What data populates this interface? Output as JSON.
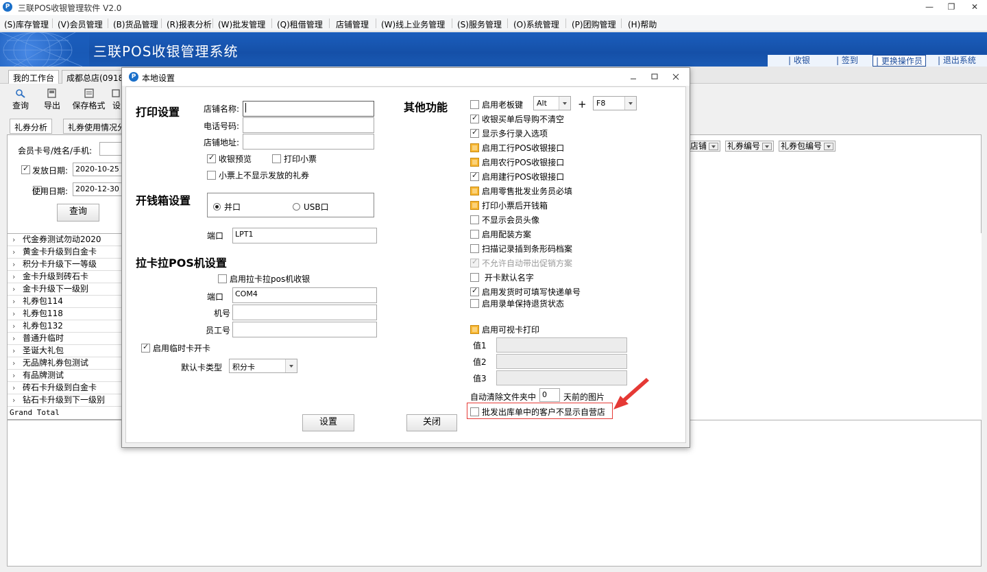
{
  "window": {
    "title": "三联POS收银管理软件 V2.0",
    "icon_letter": "P",
    "min": "—",
    "restore": "❐",
    "close": "✕"
  },
  "menu": [
    "(S)库存管理",
    "(V)会员管理",
    "(B)货品管理",
    "(R)报表分析",
    "(W)批发管理",
    "(Q)租借管理",
    "店铺管理",
    "(W)线上业务管理",
    "(S)服务管理",
    "(O)系统管理",
    "(P)团购管理",
    "(H)帮助"
  ],
  "banner": {
    "title": "三联POS收银管理系统",
    "actions": [
      "收银",
      "签到",
      "更换操作员",
      "退出系统"
    ]
  },
  "worktabs": [
    "我的工作台",
    "成都总店(0918)"
  ],
  "toolbar": {
    "query": "查询",
    "export": "导出",
    "save_format": "保存格式",
    "partial": "设"
  },
  "content_tabs": [
    "礼券分析",
    "礼券使用情况分"
  ],
  "filter": {
    "member_label": "会员卡号/姓名/手机:",
    "issue_date_label": "发放日期:",
    "issue_date_value": "2020-10-25",
    "use_date_label": "使用日期:",
    "use_date_value": "2020-12-30",
    "query_button": "查询",
    "field_headers": [
      "店铺",
      "礼券编号",
      "礼券包编号"
    ]
  },
  "tree": {
    "items": [
      "代金券测试勿动2020",
      "黄金卡升级到白金卡",
      "积分卡升级下一等级",
      "金卡升级到砖石卡",
      "金卡升级下一级别",
      "礼券包114",
      "礼券包118",
      "礼券包132",
      "普通升临时",
      "圣诞大礼包",
      "无品牌礼券包测试",
      "有品牌测试",
      "砖石卡升级到白金卡",
      "钻石卡升级到下一级别"
    ],
    "grand_total": "Grand Total"
  },
  "dialog": {
    "title": "本地设置",
    "icon_letter": "P",
    "print": {
      "section": "打印设置",
      "store_name_label": "店铺名称:",
      "phone_label": "电话号码:",
      "address_label": "店铺地址:",
      "preview_label": "收银预览",
      "print_receipt_label": "打印小票",
      "hide_coupons_label": "小票上不显示发放的礼券"
    },
    "cashbox": {
      "section": "开钱箱设置",
      "parallel_label": "并口",
      "usb_label": "USB口",
      "port_label": "端口",
      "port_value": "LPT1"
    },
    "lakala": {
      "section": "拉卡拉POS机设置",
      "enable_label": "启用拉卡拉pos机收银",
      "port_label": "端口",
      "port_value": "COM4",
      "machine_label": "机号",
      "staff_label": "员工号"
    },
    "temp_card": {
      "enable_label": "启用临时卡开卡",
      "default_type_label": "默认卡类型",
      "default_type_value": "积分卡"
    },
    "other": {
      "section": "其他功能",
      "boss_key_label": "启用老板键",
      "key1": "Alt",
      "plus": "+",
      "key2": "F8",
      "options": [
        {
          "label": "收银买单后导购不清空",
          "state": "checked"
        },
        {
          "label": "显示多行录入选项",
          "state": "checked"
        },
        {
          "label": "启用工行POS收银接口",
          "state": "yellow"
        },
        {
          "label": "启用农行POS收银接口",
          "state": "yellow"
        },
        {
          "label": "启用建行POS收银接口",
          "state": "checked"
        },
        {
          "label": "启用零售批发业务员必填",
          "state": "yellow"
        },
        {
          "label": "打印小票后开钱箱",
          "state": "yellow"
        },
        {
          "label": "不显示会员头像",
          "state": "off"
        },
        {
          "label": "启用配装方案",
          "state": "off"
        },
        {
          "label": "扫描记录插到条形码档案",
          "state": "off"
        },
        {
          "label": "不允许自动带出促销方案",
          "state": "disabled"
        },
        {
          "label": " 开卡默认名字",
          "state": "off"
        },
        {
          "label": "启用发货时可填写快递单号",
          "state": "checked"
        },
        {
          "label": "启用录单保持退货状态",
          "state": "off"
        }
      ],
      "visual_card_label": "启用可视卡打印",
      "value1_label": "值1",
      "value2_label": "值2",
      "value3_label": "值3",
      "auto_clear_label": "自动清除文件夹中",
      "auto_clear_days": "0",
      "auto_clear_suffix": "天前的图片",
      "wholesale_hide_label": "批发出库单中的客户不显示自营店"
    },
    "buttons": {
      "save": "设置",
      "close": "关闭"
    },
    "highlight_color": "#e53935"
  }
}
